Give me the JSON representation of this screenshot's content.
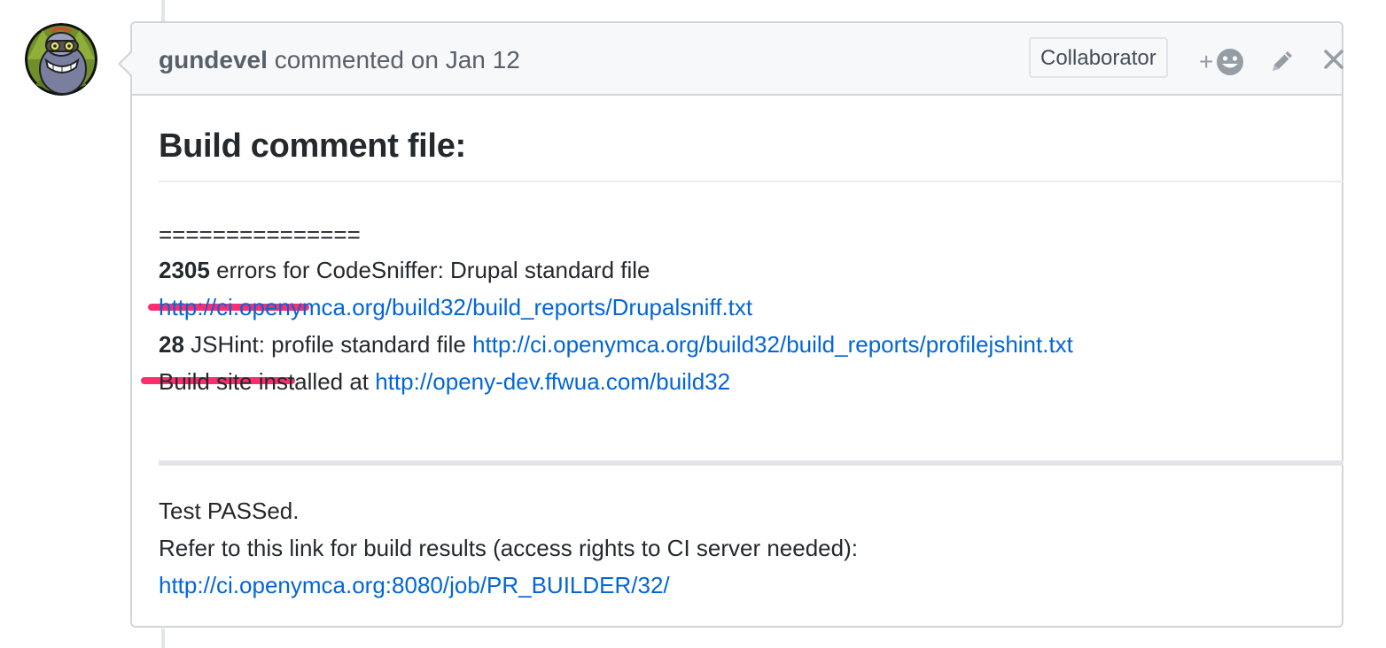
{
  "comment": {
    "author": "gundevel",
    "action_text": "commented on",
    "date": "Jan 12",
    "badge": "Collaborator"
  },
  "body": {
    "title": "Build comment file:",
    "separator": "===============",
    "line1": {
      "count": "2305",
      "text_a": " errors",
      "text_b": " for CodeSniffer: Drupal standard file"
    },
    "link1": "http://ci.openymca.org/build32/build_reports/Drupalsniff.txt",
    "line2": {
      "count": "28",
      "text_a": " JSHint:",
      "text_b": " profile standard file "
    },
    "link2": "http://ci.openymca.org/build32/build_reports/profilejshint.txt",
    "line3_text": "Build site installed at ",
    "link3": "http://openy-dev.ffwua.com/build32",
    "test_status": "Test PASSed.",
    "refer_text": "Refer to this link for build results (access rights to CI server needed):",
    "link4": "http://ci.openymca.org:8080/job/PR_BUILDER/32/"
  },
  "icons": {
    "reaction": "smiley-icon",
    "reaction_plus": "+",
    "edit": "pencil-icon",
    "delete": "close-icon"
  },
  "colors": {
    "link": "#0366d6",
    "highlight": "#ff2d6f",
    "header_bg": "#f6f8fa",
    "border": "#d1d5da"
  }
}
